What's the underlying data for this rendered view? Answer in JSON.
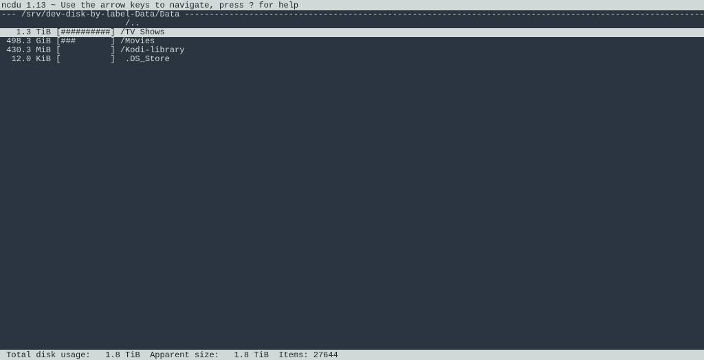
{
  "header": {
    "app_name": "ncdu",
    "version": "1.13",
    "hint": "Use the arrow keys to navigate, press ? for help"
  },
  "path": {
    "prefix": "---",
    "location": "/srv/dev-disk-by-label-Data/Data",
    "dashes": " -------------------------------------------------------------------------------------------------------------------------------------------------------------------------------------------------------"
  },
  "entries": [
    {
      "size": "",
      "unit": "",
      "bar": "          ",
      "name": "/..",
      "selected": false,
      "is_parent": true
    },
    {
      "size": "1.3",
      "unit": "TiB",
      "bar": "##########",
      "name": "/TV Shows",
      "selected": true,
      "is_parent": false
    },
    {
      "size": "498.3",
      "unit": "GiB",
      "bar": "###       ",
      "name": "/Movies",
      "selected": false,
      "is_parent": false
    },
    {
      "size": "430.3",
      "unit": "MiB",
      "bar": "          ",
      "name": "/Kodi-library",
      "selected": false,
      "is_parent": false
    },
    {
      "size": "12.0",
      "unit": "KiB",
      "bar": "          ",
      "name": " .DS_Store",
      "selected": false,
      "is_parent": false
    }
  ],
  "footer": {
    "total_label": "Total disk usage:",
    "total_value": "1.8 TiB",
    "apparent_label": "Apparent size:",
    "apparent_value": "1.8 TiB",
    "items_label": "Items:",
    "items_value": "27644"
  }
}
